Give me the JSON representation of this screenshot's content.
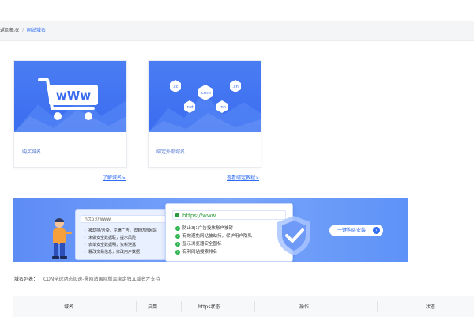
{
  "breadcrumb": {
    "back": "返回概况",
    "separator": "/",
    "current": "网站域名"
  },
  "cards": [
    {
      "label": "购买域名",
      "link": "了解域名>",
      "icon": "shopping-cart-www-icon"
    },
    {
      "label": "绑定外部域名",
      "link": "查看绑定教程>",
      "icon": "domain-suffix-icon"
    }
  ],
  "domain_suffixes": [
    ".cc",
    ".com",
    ".cn",
    ".net",
    ".top"
  ],
  "cart_text": "wWw",
  "banner": {
    "http_url": "http://www",
    "http_issues": [
      "被劫持/污染，充满广告，去到仿冒网站",
      "未做安全数据联，提示风险",
      "表单安全数据明，资料泄露",
      "篡改交易信息，修改用户数据"
    ],
    "https_url": "https://www",
    "https_benefits": [
      "防止3|1广告投放账户被封",
      "有效避免网站被劫持，保护用户隐私",
      "显示浏览器安全图标",
      "有利网站搜索排名"
    ],
    "install_button": "一键购买安装",
    "colors": {
      "accent": "#2e6cf6",
      "check": "#2bb24c"
    }
  },
  "domain_list": {
    "label": "域名列表：",
    "note": "CDN全球动态加速-需网站国际版且绑定独立域名才支持"
  },
  "table": {
    "headers": [
      "域名",
      "启用",
      "https状态",
      "操作",
      "状态"
    ]
  }
}
